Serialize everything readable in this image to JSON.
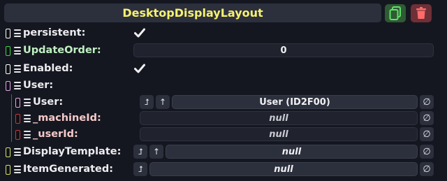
{
  "header": {
    "title": "DesktopDisplayLayout",
    "copy_icon": "duplicate-icon",
    "delete_icon": "trash-icon"
  },
  "rows": {
    "persistent": {
      "label": "persistent:",
      "checked": true,
      "tag_color": "#ffffff"
    },
    "update_order": {
      "label": "UpdateOrder:",
      "value": "0",
      "tag_color": "#3cd84b",
      "label_color": "#bff0c2"
    },
    "enabled": {
      "label": "Enabled:",
      "checked": true,
      "tag_color": "#ffffff"
    },
    "user_group": {
      "label": "User:",
      "tag_color": "#e7a6e9"
    },
    "user": {
      "label": "User:",
      "value": "User  (ID2F00)",
      "tag_color": "#e7a6e9",
      "null_symbol": "∅"
    },
    "machine_id": {
      "label": "_machineId:",
      "value": "null",
      "tag_color": "#c63a3a"
    },
    "user_id": {
      "label": "_userId:",
      "value": "null",
      "tag_color": "#c63a3a"
    },
    "display_template": {
      "label": "DisplayTemplate:",
      "value": "null",
      "tag_color": "#d4e36b",
      "null_symbol": "∅"
    },
    "item_generated": {
      "label": "ItemGenerated:",
      "value": "null",
      "tag_color": "#d4e36b",
      "null_symbol": "∅"
    }
  },
  "icons": {
    "jump": "⮥",
    "up": "↑"
  },
  "colors": {
    "title": "#f8f16e",
    "field_bg": "#20232d",
    "panel_bg": "#151720"
  }
}
